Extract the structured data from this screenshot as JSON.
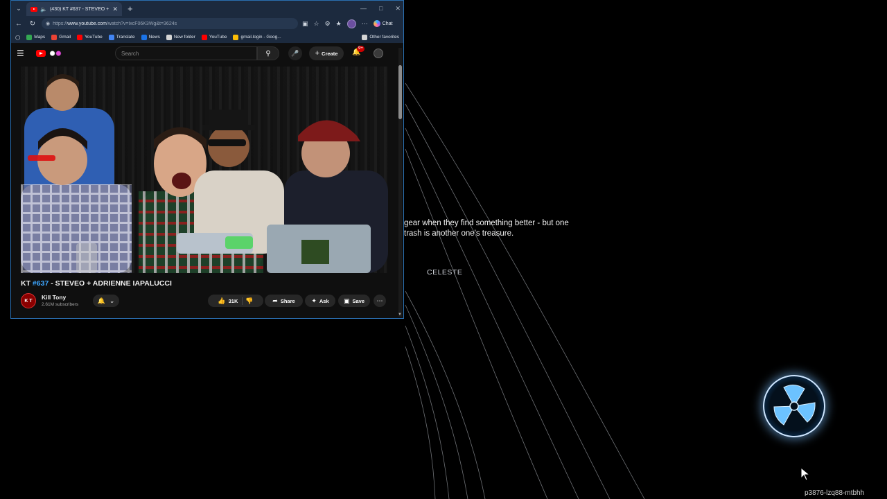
{
  "browser": {
    "tab_title": "(430) KT #637 - STEVEO + AD",
    "url_prefix": "https://",
    "url_host": "www.youtube.com",
    "url_path": "/watch?v=lxcF06K3Wg&t=3624s",
    "chat_label": "Chat",
    "bookmarks": [
      {
        "label": "Maps",
        "color": "#34a853"
      },
      {
        "label": "Gmail",
        "color": "#ea4335"
      },
      {
        "label": "YouTube",
        "color": "#ff0000"
      },
      {
        "label": "Translate",
        "color": "#4285f4"
      },
      {
        "label": "News",
        "color": "#1a73e8"
      },
      {
        "label": "New folder",
        "color": "#d4d4d4"
      },
      {
        "label": "YouTube",
        "color": "#ff0000"
      },
      {
        "label": "gmail.login - Goog...",
        "color": "#fbbc05"
      }
    ],
    "other_favorites": "Other favorites"
  },
  "youtube": {
    "search_placeholder": "Search",
    "create_label": "Create",
    "notification_badge": "9+",
    "video_title_prefix": "KT ",
    "video_title_hashtag": "#637",
    "video_title_rest": " - STEVEO + ADRIENNE IAPALUCCI",
    "channel_name": "Kill Tony",
    "channel_initials": "K T",
    "subscribers": "2.61M subscribers",
    "likes": "31K",
    "share_label": "Share",
    "ask_label": "Ask",
    "save_label": "Save",
    "scroll_progress": 0.08
  },
  "desktop": {
    "caption_line1": "gear when they find something better - but one",
    "caption_line2": "trash is another one's treasure.",
    "label": "CELESTE",
    "watermark": "p3876-lzq88-mtbhh"
  }
}
